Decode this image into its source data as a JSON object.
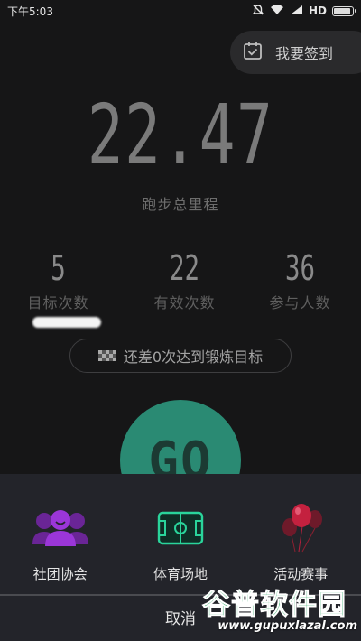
{
  "status_bar": {
    "time": "下午5:03",
    "network": "HD",
    "icons": [
      "mute-icon",
      "wifi-icon",
      "signal-icon",
      "battery-icon"
    ]
  },
  "checkin": {
    "label": "我要签到",
    "icon": "calendar-check-icon"
  },
  "summary": {
    "mileage_value": "22.47",
    "mileage_label": "跑步总里程"
  },
  "stats": [
    {
      "value": "5",
      "label": "目标次数"
    },
    {
      "value": "22",
      "label": "有效次数"
    },
    {
      "value": "36",
      "label": "参与人数"
    }
  ],
  "goal_hint": {
    "text": "还差0次达到锻炼目标",
    "icon": "finish-flag-icon"
  },
  "go_button": {
    "label": "GO",
    "color": "#2a8a73"
  },
  "action_sheet": {
    "items": [
      {
        "label": "社团协会",
        "icon": "group-icon"
      },
      {
        "label": "体育场地",
        "icon": "field-icon"
      },
      {
        "label": "活动赛事",
        "icon": "balloon-icon"
      }
    ],
    "cancel_label": "取消"
  },
  "watermark": {
    "title": "谷普软件园",
    "url": "www.gupuxlazal.com"
  },
  "colors": {
    "background": "#161617",
    "sheet": "#23242a",
    "accent_green": "#2a8a73",
    "group_purple": "#8c2fc9",
    "balloon_red": "#b3203c"
  }
}
